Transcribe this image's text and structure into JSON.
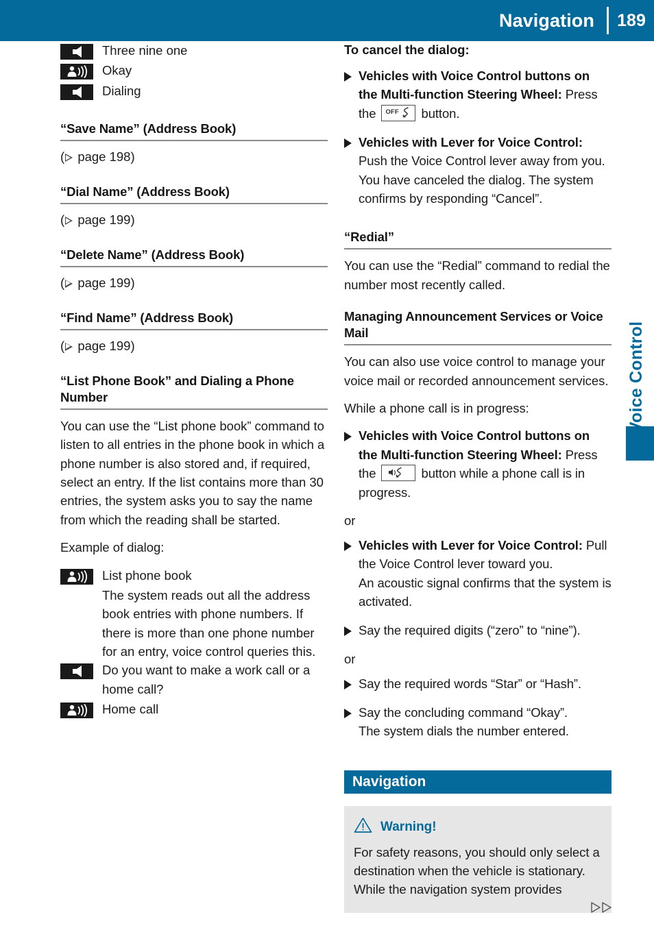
{
  "header": {
    "title": "Navigation",
    "page_number": "189",
    "accent_color": "#046A9C"
  },
  "side_tab": {
    "label": "Voice Control",
    "color": "#046A9C"
  },
  "left_column": {
    "dialog_top": [
      {
        "icon": "system-speaker-icon",
        "speaker": "system",
        "text": "Three nine one"
      },
      {
        "icon": "user-voice-icon",
        "speaker": "user",
        "text": "Okay"
      },
      {
        "icon": "system-speaker-icon",
        "speaker": "system",
        "text": "Dialing"
      }
    ],
    "reference_sections": [
      {
        "heading": "“Save Name” (Address Book)",
        "reference": "page 198"
      },
      {
        "heading": "“Dial Name” (Address Book)",
        "reference": "page 199"
      },
      {
        "heading": "“Delete Name” (Address Book)",
        "reference": "page 199"
      },
      {
        "heading": "“Find Name” (Address Book)",
        "reference": "page 199"
      }
    ],
    "list_phone_book": {
      "heading": "“List Phone Book” and Dialing a Phone Number",
      "body": "You can use the “List phone book” command to listen to all entries in the phone book in which a phone number is also stored and, if required, select an entry. If the list contains more than 30 entries, the system asks you to say the name from which the reading shall be started.",
      "example_label": "Example of dialog:",
      "dialog": [
        {
          "icon": "user-voice-icon",
          "speaker": "user",
          "text": "List phone book",
          "sub": "The system reads out all the address book entries with phone numbers. If there is more than one phone number for an entry, voice control queries this."
        },
        {
          "icon": "system-speaker-icon",
          "speaker": "system",
          "text": "Do you want to make a work call or a home call?",
          "sub": ""
        },
        {
          "icon": "user-voice-icon",
          "speaker": "user",
          "text": "Home call",
          "sub": ""
        }
      ]
    }
  },
  "right_column": {
    "cancel_dialog": {
      "heading": "To cancel the dialog:",
      "items": [
        {
          "bold_lead": "Vehicles with Voice Control buttons on the Multi-function Steering Wheel:",
          "text_before_key": " Press the ",
          "key_icon": "hangup-off-button-icon",
          "key_label": "OFF",
          "text_after_key": " button."
        },
        {
          "bold_lead": "Vehicles with Lever for Voice Control:",
          "text_before_key": " Push the Voice Control lever away from you.",
          "extra_line": "You have canceled the dialog. The system confirms by responding “Cancel”."
        }
      ]
    },
    "redial": {
      "heading": "“Redial”",
      "body": "You can use the “Redial” command to redial the number most recently called."
    },
    "announcement_services": {
      "heading": "Managing Announcement Services or Voice Mail",
      "body": "You can also use voice control to manage your voice mail or recorded announcement services.",
      "intro": "While a phone call is in progress:",
      "items": [
        {
          "bold_lead": "Vehicles with Voice Control buttons on the Multi-function Steering Wheel:",
          "text_before_key": " Press the ",
          "key_icon": "voice-talk-button-icon",
          "text_after_key": " button while a phone call is in progress."
        },
        {
          "bold_lead": "Vehicles with Lever for Voice Control:",
          "text_before_key": " Pull the Voice Control lever toward you.",
          "extra_line": "An acoustic signal confirms that the system is activated."
        }
      ],
      "or_label_1": "or",
      "or_label_2": "or",
      "steps": [
        {
          "text": "Say the required digits (“zero” to “nine”)."
        },
        {
          "text": "Say the required words “Star” or “Hash”."
        },
        {
          "text": "Say the concluding command “Okay”.",
          "sub": "The system dials the number entered."
        }
      ]
    },
    "navigation_chapter": {
      "bar_label": "Navigation",
      "warning": {
        "icon": "warning-triangle-icon",
        "title": "Warning!",
        "text": "For safety reasons, you should only select a destination when the vehicle is stationary. While the navigation system provides"
      }
    }
  },
  "footer": {
    "continuation_icon": "double-triangle-continuation-icon"
  }
}
